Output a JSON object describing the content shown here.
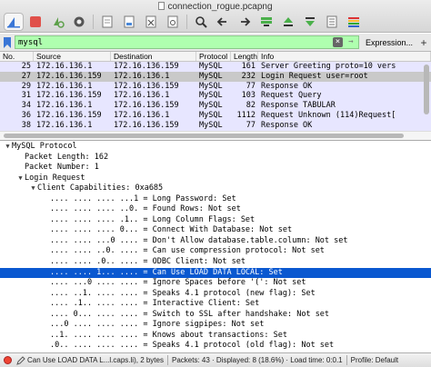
{
  "window": {
    "title": "connection_rogue.pcapng"
  },
  "toolbar": {
    "buttons": [
      {
        "icon": "shark-fin-start-icon"
      },
      {
        "icon": "stop-capture-icon"
      },
      {
        "icon": "restart-capture-icon"
      },
      {
        "icon": "capture-options-gear-icon"
      },
      {
        "icon": "open-file-icon"
      },
      {
        "icon": "save-file-icon"
      },
      {
        "icon": "close-file-icon"
      },
      {
        "icon": "reload-icon"
      },
      {
        "icon": "find-packet-icon"
      },
      {
        "icon": "go-back-icon"
      },
      {
        "icon": "go-forward-icon"
      },
      {
        "icon": "go-to-packet-icon"
      },
      {
        "icon": "go-first-icon"
      },
      {
        "icon": "go-last-icon"
      },
      {
        "icon": "auto-scroll-icon"
      },
      {
        "icon": "colorize-icon"
      }
    ]
  },
  "filter": {
    "value": "mysql",
    "clear_label": "×",
    "apply_label": "→",
    "expression_label": "Expression...",
    "add_label": "+"
  },
  "packet_list": {
    "columns": [
      "No.",
      "Source",
      "Destination",
      "Protocol",
      "Length",
      "Info"
    ],
    "rows": [
      {
        "no": "25",
        "src": "172.16.136.1",
        "dst": "172.16.136.159",
        "proto": "MySQL",
        "len": "161",
        "info": "Server Greeting proto=10 vers",
        "selected": false
      },
      {
        "no": "27",
        "src": "172.16.136.159",
        "dst": "172.16.136.1",
        "proto": "MySQL",
        "len": "232",
        "info": "Login Request user=root",
        "selected": true
      },
      {
        "no": "29",
        "src": "172.16.136.1",
        "dst": "172.16.136.159",
        "proto": "MySQL",
        "len": "77",
        "info": "Response OK",
        "selected": false
      },
      {
        "no": "31",
        "src": "172.16.136.159",
        "dst": "172.16.136.1",
        "proto": "MySQL",
        "len": "103",
        "info": "Request Query",
        "selected": false
      },
      {
        "no": "34",
        "src": "172.16.136.1",
        "dst": "172.16.136.159",
        "proto": "MySQL",
        "len": "82",
        "info": "Response TABULAR",
        "selected": false
      },
      {
        "no": "36",
        "src": "172.16.136.159",
        "dst": "172.16.136.1",
        "proto": "MySQL",
        "len": "1112",
        "info": "Request Unknown (114)Request[",
        "selected": false
      },
      {
        "no": "38",
        "src": "172.16.136.1",
        "dst": "172.16.136.159",
        "proto": "MySQL",
        "len": "77",
        "info": "Response OK",
        "selected": false
      }
    ]
  },
  "details": {
    "rows": [
      {
        "indent": 0,
        "toggle": "▼",
        "text": "MySQL Protocol",
        "selected": false
      },
      {
        "indent": 1,
        "toggle": "",
        "text": "Packet Length: 162",
        "selected": false
      },
      {
        "indent": 1,
        "toggle": "",
        "text": "Packet Number: 1",
        "selected": false
      },
      {
        "indent": 1,
        "toggle": "▼",
        "text": "Login Request",
        "selected": false
      },
      {
        "indent": 2,
        "toggle": "▼",
        "text": "Client Capabilities: 0xa685",
        "selected": false
      },
      {
        "indent": 3,
        "toggle": "",
        "text": ".... .... .... ...1 = Long Password: Set",
        "selected": false
      },
      {
        "indent": 3,
        "toggle": "",
        "text": ".... .... .... ..0. = Found Rows: Not set",
        "selected": false
      },
      {
        "indent": 3,
        "toggle": "",
        "text": ".... .... .... .1.. = Long Column Flags: Set",
        "selected": false
      },
      {
        "indent": 3,
        "toggle": "",
        "text": ".... .... .... 0... = Connect With Database: Not set",
        "selected": false
      },
      {
        "indent": 3,
        "toggle": "",
        "text": ".... .... ...0 .... = Don't Allow database.table.column: Not set",
        "selected": false
      },
      {
        "indent": 3,
        "toggle": "",
        "text": ".... .... ..0. .... = Can use compression protocol: Not set",
        "selected": false
      },
      {
        "indent": 3,
        "toggle": "",
        "text": ".... .... .0.. .... = ODBC Client: Not set",
        "selected": false
      },
      {
        "indent": 3,
        "toggle": "",
        "text": ".... .... 1... .... = Can Use LOAD DATA LOCAL: Set",
        "selected": true
      },
      {
        "indent": 3,
        "toggle": "",
        "text": ".... ...0 .... .... = Ignore Spaces before '(': Not set",
        "selected": false
      },
      {
        "indent": 3,
        "toggle": "",
        "text": ".... ..1. .... .... = Speaks 4.1 protocol (new flag): Set",
        "selected": false
      },
      {
        "indent": 3,
        "toggle": "",
        "text": ".... .1.. .... .... = Interactive Client: Set",
        "selected": false
      },
      {
        "indent": 3,
        "toggle": "",
        "text": ".... 0... .... .... = Switch to SSL after handshake: Not set",
        "selected": false
      },
      {
        "indent": 3,
        "toggle": "",
        "text": "...0 .... .... .... = Ignore sigpipes: Not set",
        "selected": false
      },
      {
        "indent": 3,
        "toggle": "",
        "text": "..1. .... .... .... = Knows about transactions: Set",
        "selected": false
      },
      {
        "indent": 3,
        "toggle": "",
        "text": ".0.. .... .... .... = Speaks 4.1 protocol (old flag): Not set",
        "selected": false
      }
    ]
  },
  "status": {
    "field": "Can Use LOAD DATA L...l.caps.li), 2 bytes",
    "packets": "Packets: 43 · Displayed: 8 (18.6%) · Load time: 0:0.1",
    "profile": "Profile: Default"
  },
  "colors": {
    "row_bg": "#e7e6ff",
    "row_selected": "#c9c9c9",
    "filter_ok": "#afffaf",
    "detail_selected": "#0a58d0"
  }
}
